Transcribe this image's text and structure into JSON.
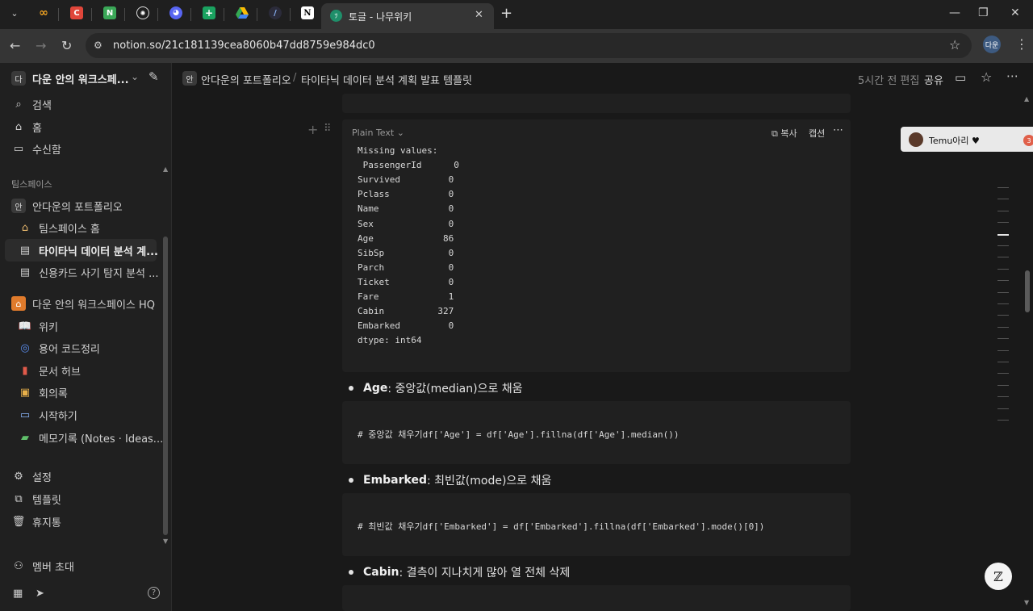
{
  "browser": {
    "tabs": [
      {
        "icon": "chevron-down-icon"
      },
      {
        "icon": "infinity-icon",
        "color": "#f5a623"
      },
      {
        "icon": "c-app-icon",
        "color": "#e0463a",
        "glyph": "C"
      },
      {
        "icon": "n-app-icon",
        "color": "#3aa757",
        "glyph": "N"
      },
      {
        "icon": "openai-icon"
      },
      {
        "icon": "discord-icon",
        "color": "#5865f2"
      },
      {
        "icon": "sheets-icon",
        "color": "#1aa260"
      },
      {
        "icon": "drive-icon"
      },
      {
        "icon": "slash-app-icon"
      },
      {
        "icon": "notion-icon"
      }
    ],
    "active_tab_title": "토글 - 나무위키",
    "url": "notion.so/21c181139cea8060b47dd8759e984dc0",
    "profile_label": "다운"
  },
  "sidebar": {
    "workspace_badge": "다",
    "workspace_name": "다운 안의 워크스페...",
    "search": "검색",
    "home": "홈",
    "inbox": "수신함",
    "teamspace_header": "팀스페이스",
    "teamspace_badge": "안",
    "teamspace_name": "안다운의 포트폴리오",
    "teamspace_home": "팀스페이스 홈",
    "page_titanic": "타이타닉 데이터 분석 계...",
    "page_credit": "신용카드 사기 탐지 분석 ...",
    "hq_name": "다운 안의 워크스페이스 HQ",
    "wiki": "위키",
    "glossary": "용어 코드정리",
    "docs_hub": "문서 허브",
    "meetings": "회의록",
    "getting_started": "시작하기",
    "memo": "메모기록 (Notes · Ideas...",
    "settings": "설정",
    "templates": "템플릿",
    "trash": "휴지통",
    "invite": "멤버 초대"
  },
  "topbar": {
    "crumb_badge": "안",
    "crumb_1": "안다운의 포트폴리오",
    "crumb_sep": "/",
    "crumb_2": "타이타닉 데이터 분석 계획 발표 템플릿",
    "edited": "5시간 전 편집",
    "share": "공유"
  },
  "code_toolbar": {
    "language": "Plain Text",
    "copy": "복사",
    "caption": "캡션"
  },
  "missing_values": [
    "Missing values:",
    " PassengerId      0",
    "Survived         0",
    "Pclass           0",
    "Name             0",
    "Sex              0",
    "Age             86",
    "SibSp            0",
    "Parch            0",
    "Ticket           0",
    "Fare             1",
    "Cabin          327",
    "Embarked         0",
    "dtype: int64"
  ],
  "bullets": {
    "age_key": "Age",
    "age_text": ": 중앙값(median)으로 채움",
    "age_code": "# 중앙값 채우기df['Age'] = df['Age'].fillna(df['Age'].median())",
    "emb_key": "Embarked",
    "emb_text": ": 최빈값(mode)으로 채움",
    "emb_code": "# 최빈값 채우기df['Embarked'] = df['Embarked'].fillna(df['Embarked'].mode()[0])",
    "cabin_key": "Cabin",
    "cabin_text": ": 결측이 지나치게 많아 열 전체 삭제"
  },
  "widgets": {
    "temu_label": "Temu아리 ♥",
    "temu_count": "3",
    "fab_glyph": "ℤ"
  }
}
